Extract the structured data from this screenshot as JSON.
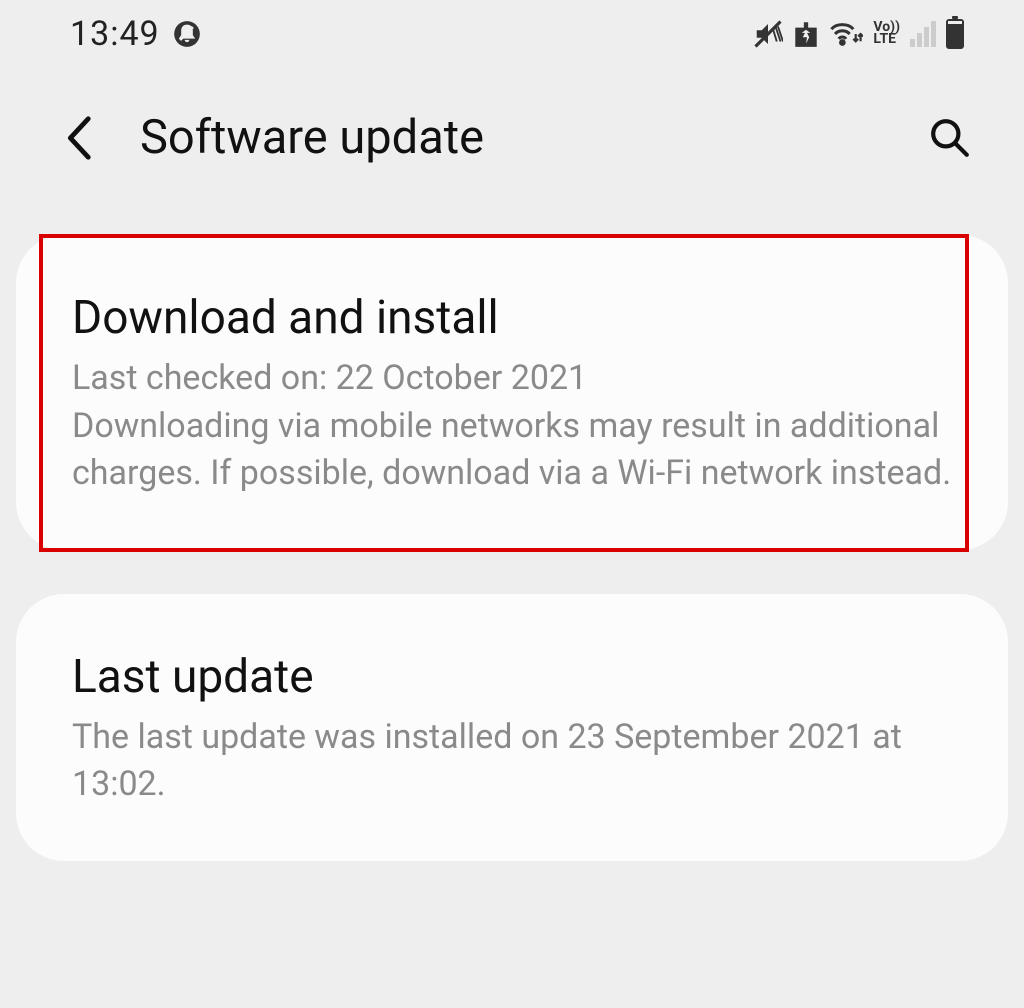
{
  "statusBar": {
    "time": "13:49"
  },
  "header": {
    "title": "Software update"
  },
  "cards": {
    "download": {
      "title": "Download and install",
      "lastChecked": "Last checked on: 22 October 2021",
      "description": "Downloading via mobile networks may result in additional charges. If possible, download via a Wi-Fi network instead."
    },
    "lastUpdate": {
      "title": "Last update",
      "description": "The last update was installed on 23 September 2021 at 13:02."
    }
  }
}
